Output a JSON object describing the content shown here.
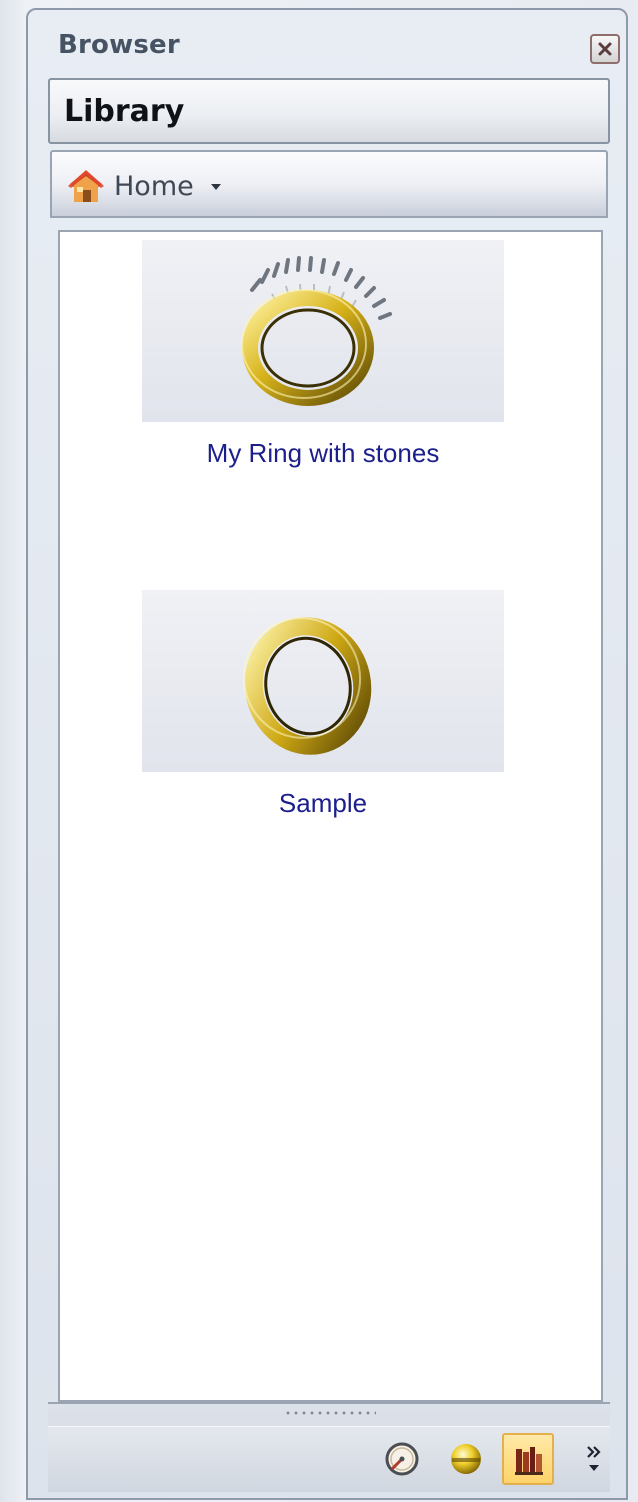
{
  "panel": {
    "title": "Browser",
    "close_icon": "close-icon"
  },
  "library": {
    "title": "Library"
  },
  "navigation": {
    "home_label": "Home",
    "home_icon": "house-icon",
    "dropdown_icon": "caret-down-icon"
  },
  "items": [
    {
      "label": "My Ring with stones",
      "thumbnail_icon": "gold-ring-with-stones-icon"
    },
    {
      "label": "Sample",
      "thumbnail_icon": "gold-ring-icon"
    }
  ],
  "toolbar": {
    "tools": [
      {
        "icon": "gauge-icon",
        "active": false
      },
      {
        "icon": "gold-sphere-icon",
        "active": false
      },
      {
        "icon": "books-library-icon",
        "active": true
      }
    ],
    "overflow_icon": "chevron-double-right-icon"
  },
  "colors": {
    "item_label": "#1c1e8c",
    "active_tool": "#ffd36b",
    "panel_border": "#8e9aaa"
  }
}
